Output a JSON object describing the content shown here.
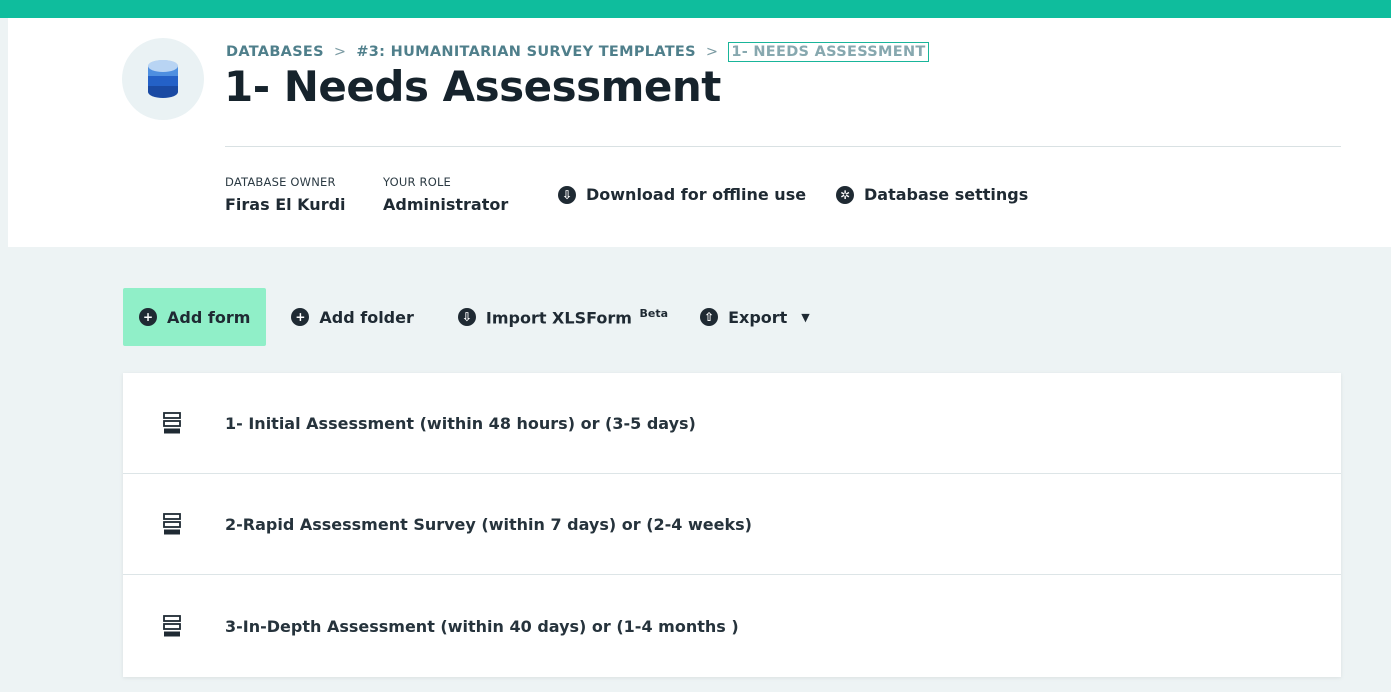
{
  "breadcrumb": {
    "items": [
      "DATABASES",
      "#3: HUMANITARIAN SURVEY TEMPLATES"
    ],
    "separator": ">",
    "current": "1- NEEDS ASSESSMENT"
  },
  "page": {
    "title": "1- Needs Assessment"
  },
  "meta": {
    "owner_label": "DATABASE OWNER",
    "owner_value": "Firas El Kurdi",
    "role_label": "YOUR ROLE",
    "role_value": "Administrator"
  },
  "header_actions": {
    "download_label": "Download for offline use",
    "settings_label": "Database settings"
  },
  "toolbar": {
    "add_form_label": "Add form",
    "add_folder_label": "Add folder",
    "import_label": "Import XLSForm",
    "import_badge": "Beta",
    "export_label": "Export"
  },
  "forms": [
    {
      "label": "1- Initial Assessment (within 48 hours) or (3-5 days)"
    },
    {
      "label": "2-Rapid Assessment Survey (within 7 days) or (2-4 weeks)"
    },
    {
      "label": "3-In-Depth Assessment (within 40 days) or (1-4 months )"
    }
  ],
  "icons": {
    "database": "database-icon",
    "download": "download-icon",
    "settings": "gear-icon",
    "add": "plus-circle-icon",
    "import": "import-icon",
    "export": "export-icon",
    "form": "form-icon",
    "caret": "caret-down-icon"
  },
  "colors": {
    "top_bar": "#0fbd9d",
    "primary_button": "#90efc8",
    "page_background": "#edf3f4",
    "breadcrumb_text": "#4f7f8b"
  }
}
